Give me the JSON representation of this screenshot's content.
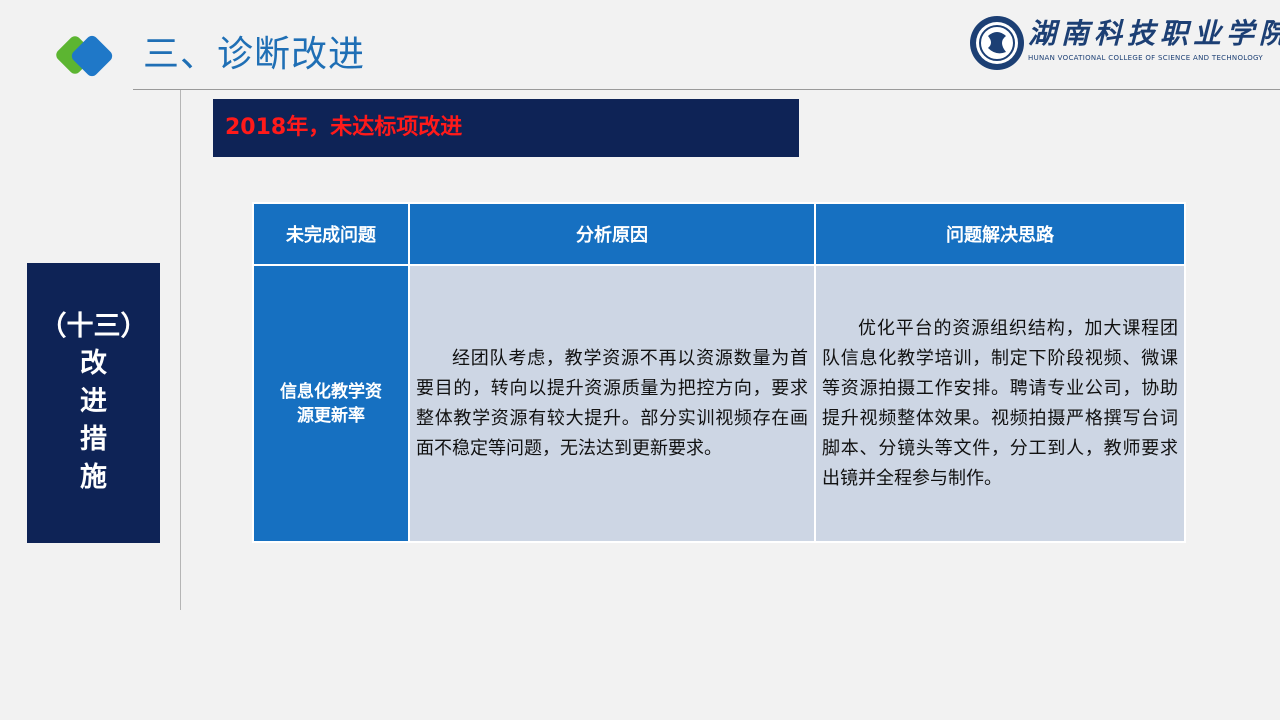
{
  "header": {
    "section_title": "三、诊断改进",
    "brand_name": "湖南科技职业学院",
    "brand_english": "HUNAN VOCATIONAL COLLEGE OF SCIENCE AND TECHNOLOGY"
  },
  "banner": {
    "text": "2018年，未达标项改进"
  },
  "sidebar": {
    "paren_text": "（十三）",
    "chars": [
      "改",
      "进",
      "措",
      "施"
    ]
  },
  "table": {
    "headers": [
      "未完成问题",
      "分析原因",
      "问题解决思路"
    ],
    "rows": [
      {
        "problem": "信息化教学资源更新率",
        "reason": "经团队考虑，教学资源不再以资源数量为首要目的，转向以提升资源质量为把控方向，要求整体教学资源有较大提升。部分实训视频存在画面不稳定等问题，无法达到更新要求。",
        "solution": "优化平台的资源组织结构，加大课程团队信息化教学培训，制定下阶段视频、微课等资源拍摄工作安排。聘请专业公司，协助提升视频整体效果。视频拍摄严格撰写台词脚本、分镜头等文件，分工到人，教师要求出镜并全程参与制作。"
      }
    ]
  },
  "colors": {
    "title_blue": "#1f6fb5",
    "navy": "#0e2356",
    "banner_red": "#ff1a1a",
    "header_blue": "#1670c1",
    "cell_fill": "#cdd6e4",
    "logo_green": "#5cb531",
    "logo_blue": "#1f78c8"
  },
  "icons": {
    "title_mark": "diamond-logo-icon",
    "college_seal": "college-seal-icon"
  }
}
